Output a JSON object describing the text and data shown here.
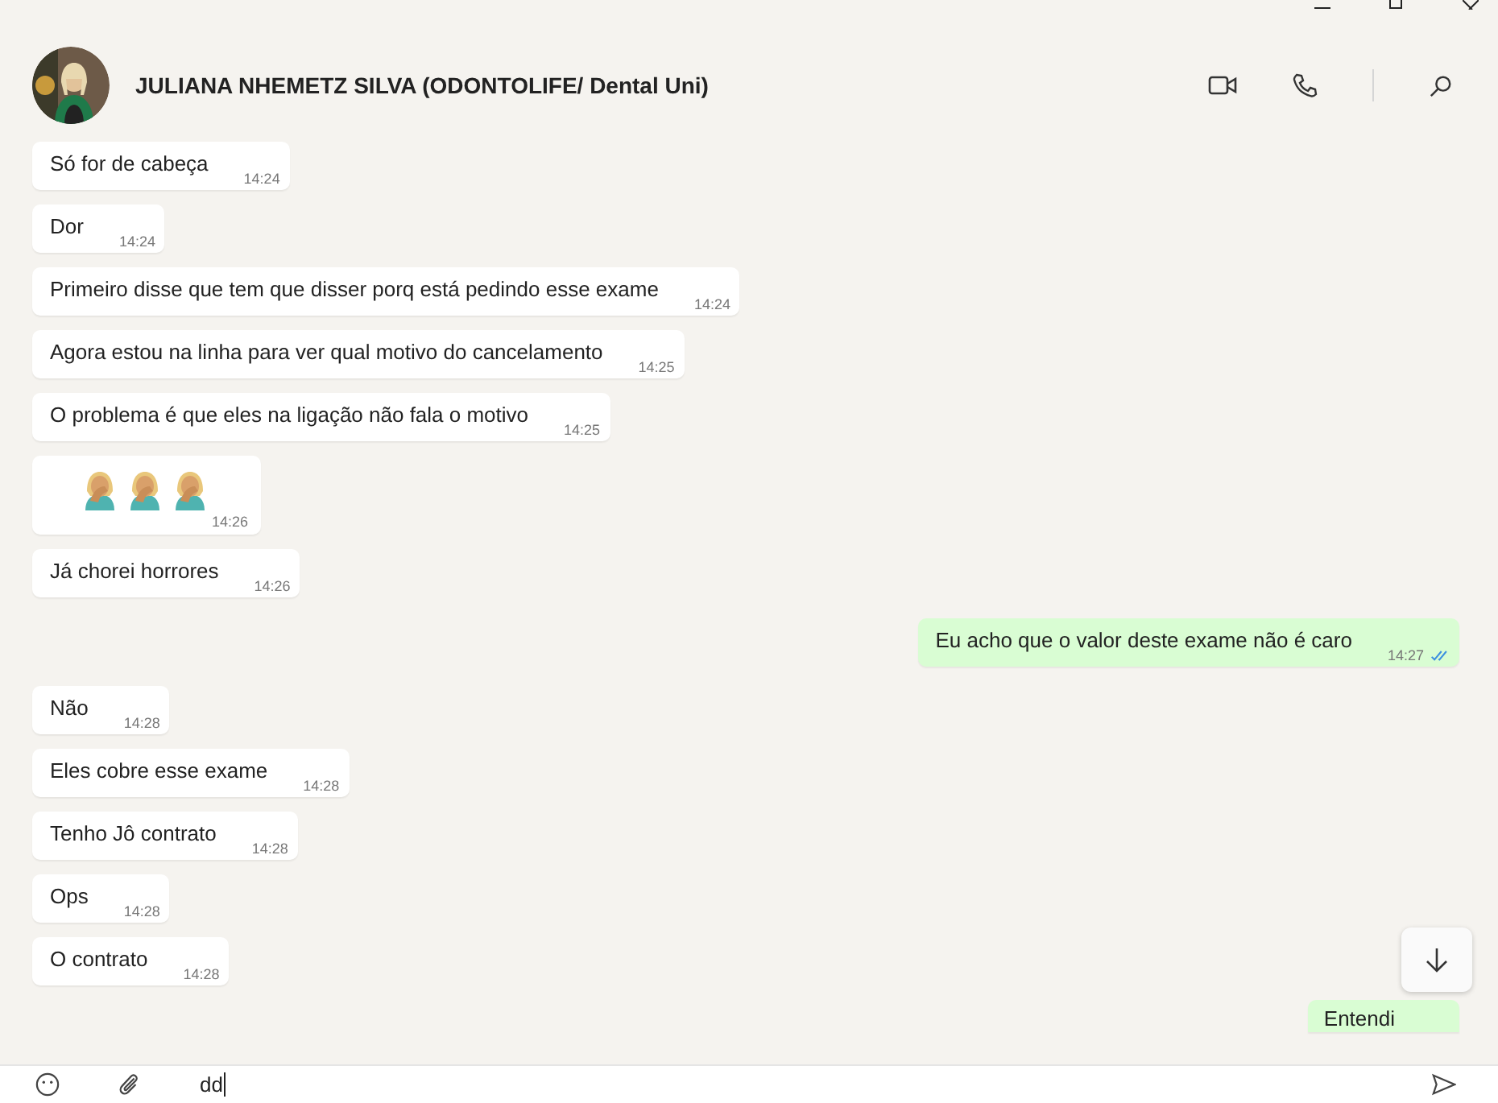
{
  "header": {
    "contact_name": "JULIANA NHEMETZ SILVA (ODONTOLIFE/ Dental Uni)"
  },
  "messages": [
    {
      "kind": "text",
      "outgoing": false,
      "text": "Só for de cabeça",
      "time": "14:24"
    },
    {
      "kind": "text",
      "outgoing": false,
      "text": "Dor",
      "time": "14:24"
    },
    {
      "kind": "text",
      "outgoing": false,
      "text": "Primeiro disse que tem que disser porq está pedindo esse exame",
      "time": "14:24"
    },
    {
      "kind": "text",
      "outgoing": false,
      "text": "Agora estou na linha para ver qual motivo do cancelamento",
      "time": "14:25"
    },
    {
      "kind": "text",
      "outgoing": false,
      "text": "O problema é que eles na ligação não fala o motivo",
      "time": "14:25"
    },
    {
      "kind": "emoji",
      "outgoing": false,
      "emojis": [
        {
          "kind": "facepalm"
        },
        {
          "kind": "facepalm"
        },
        {
          "kind": "facepalm"
        }
      ],
      "time": "14:26"
    },
    {
      "kind": "text",
      "outgoing": false,
      "text": "Já chorei horrores",
      "time": "14:26"
    },
    {
      "kind": "text",
      "outgoing": true,
      "text": "Eu acho que o valor deste exame não é caro",
      "time": "14:27",
      "read": true
    },
    {
      "kind": "text",
      "outgoing": false,
      "text": "Não",
      "time": "14:28"
    },
    {
      "kind": "text",
      "outgoing": false,
      "text": "Eles cobre esse exame",
      "time": "14:28"
    },
    {
      "kind": "text",
      "outgoing": false,
      "text": "Tenho Jô contrato",
      "time": "14:28"
    },
    {
      "kind": "text",
      "outgoing": false,
      "text": "Ops",
      "time": "14:28"
    },
    {
      "kind": "text",
      "outgoing": false,
      "text": "O contrato",
      "time": "14:28"
    },
    {
      "kind": "partial",
      "outgoing": true,
      "text": "Entendi"
    }
  ],
  "composer": {
    "value": "dd"
  }
}
